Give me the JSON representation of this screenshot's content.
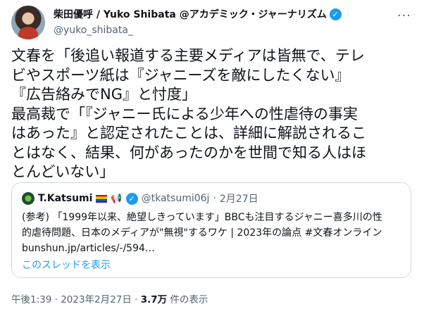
{
  "author": {
    "name": "柴田優呼 / Yuko Shibata @アカデミック・ジャーナリズム",
    "handle": "@yuko_shibata_",
    "verified_icon": "verified-badge-icon",
    "more_label": "···"
  },
  "tweet": {
    "text": "文春を「後追い報道する主要メディアは皆無で、テレ\nビやスポーツ紙は『ジャニーズを敵にしたくない』\n『広告絡みでNG』と忖度」\n最高裁で「『ジャニー氏による少年への性虐待の事実\nはあった』と認定されたことは、詳細に解説されるこ\nとはなく、結果、何があったのかを世間で知る人はほ\nとんどいない」"
  },
  "quote": {
    "name": "T.Katsumi",
    "handle": "@tkatsumi06j",
    "separator": "·",
    "date": "2月27日",
    "body": "(参考) 「1999年以来、絶望しきっています」BBCも注目するジャニー喜多川の性\n的虐待問題、日本のメディアが\"無視\"するワケ | 2023年の論点 #文春オンライン\nbunshun.jp/articles/-/594…",
    "thread_link": "このスレッドを表示"
  },
  "footer": {
    "time": "午後1:39",
    "separator": " · ",
    "date": "2023年2月27日",
    "separator2": " · ",
    "views": "3.7万",
    "views_label": " 件の表示"
  }
}
